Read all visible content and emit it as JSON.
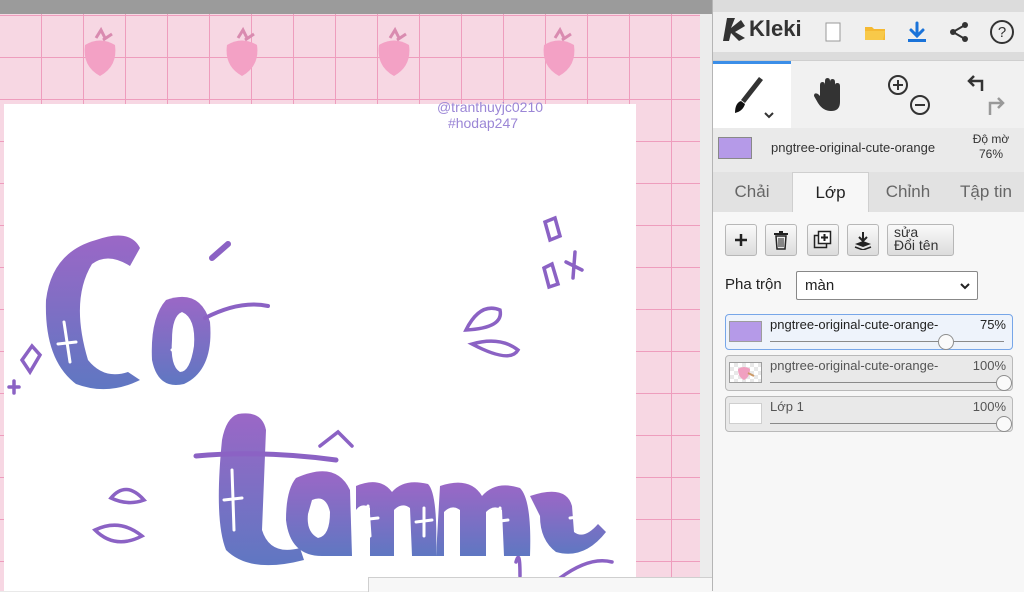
{
  "app": {
    "name": "Kleki"
  },
  "canvas": {
    "watermark_line1": "@tranthuyjc0210",
    "watermark_line2": "#hodap247",
    "artwork_text": "Có tâm"
  },
  "brush": {
    "swatch_color": "#b59ae8",
    "name": "pngtree-original-cute-orange",
    "opacity_label": "Độ mờ",
    "opacity_value": "76%"
  },
  "tabs": [
    "Chải",
    "Lớp",
    "Chỉnh",
    "Tập tin"
  ],
  "active_tab": "Lớp",
  "layer_buttons": {
    "rename_line1": "sửa",
    "rename_line2": "Đổi tên"
  },
  "blend": {
    "label": "Pha trộn",
    "value": "màn"
  },
  "layers": [
    {
      "name": "pngtree-original-cute-orange-",
      "opacity": "75%",
      "opacity_fraction": 0.75,
      "selected": true
    },
    {
      "name": "pngtree-original-cute-orange-",
      "opacity": "100%",
      "opacity_fraction": 1.0,
      "selected": false
    },
    {
      "name": "Lớp 1",
      "opacity": "100%",
      "opacity_fraction": 1.0,
      "selected": false
    }
  ],
  "colors": {
    "accent": "#3b8ee8",
    "lettering_top": "#9b67c6",
    "lettering_bottom": "#5f77c2",
    "grid_bg": "#f7d7e3"
  }
}
